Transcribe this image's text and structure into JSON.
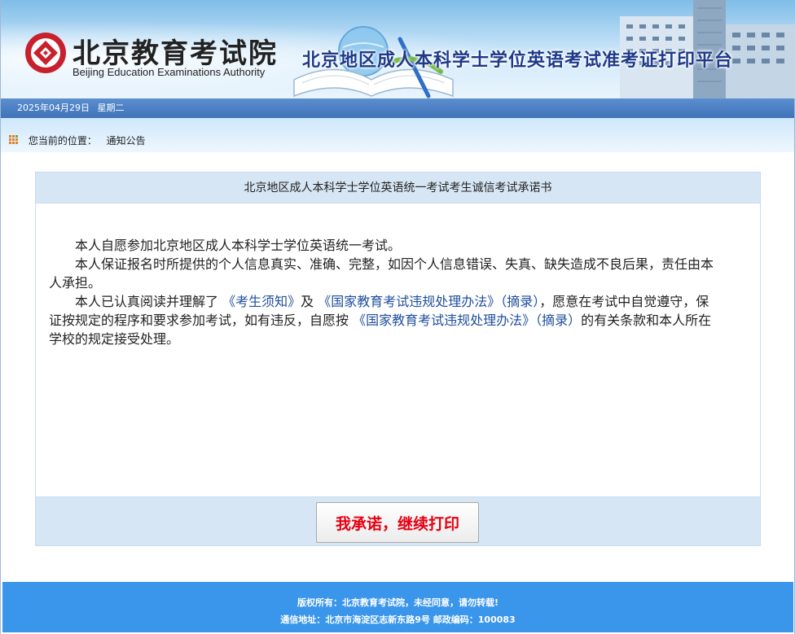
{
  "header": {
    "logo_cn": "北京教育考试院",
    "logo_en": "Beijing Education Examinations Authority",
    "platform_title": "北京地区成人本科学士学位英语考试准考证打印平台"
  },
  "date_bar": {
    "date": "2025年04月29日",
    "weekday": "星期二"
  },
  "breadcrumb": {
    "label": "您当前的位置：",
    "current": "通知公告"
  },
  "panel": {
    "title": "北京地区成人本科学士学位英语统一考试考生诚信考试承诺书",
    "p1": "本人自愿参加北京地区成人本科学士学位英语统一考试。",
    "p2": "本人保证报名时所提供的个人信息真实、准确、完整，如因个人信息错误、失真、缺失造成不良后果，责任由本人承担。",
    "p3_a": "本人已认真阅读并理解了",
    "link_notice": "《考生须知》",
    "p3_b": "及",
    "link_rules": "《国家教育考试违规处理办法》（摘录）",
    "p3_c": "，愿意在考试中自觉遵守，保证按规定的程序和要求参加考试，如有违反，自愿按",
    "link_rules2": "《国家教育考试违规处理办法》（摘录）",
    "p3_d": "的有关条款和本人所在学校的规定接受处理。",
    "button_label": "我承诺，继续打印"
  },
  "footer": {
    "copyright": "版权所有：北京教育考试院，未经同意，请勿转载!",
    "address": "通信地址：北京市海淀区志新东路9号 邮政编码：100083"
  },
  "colors": {
    "accent": "#3a96ea",
    "title_blue": "#1e3a8a",
    "button_red": "#e60012",
    "panel_bg": "#d6e6f4"
  }
}
